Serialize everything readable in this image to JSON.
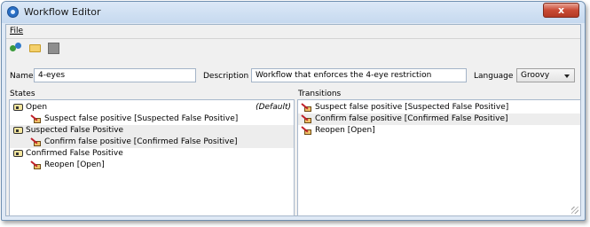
{
  "window": {
    "title": "Workflow Editor",
    "close_label": "x"
  },
  "menu": {
    "file": "File"
  },
  "toolbar": {
    "buttons": [
      {
        "icon": "new-workflow-icon"
      },
      {
        "icon": "open-folder-icon"
      },
      {
        "icon": "save-icon"
      }
    ]
  },
  "form": {
    "name_label": "Name",
    "name_value": "4-eyes",
    "description_label": "Description",
    "description_value": "Workflow that enforces the 4-eye restriction",
    "language_label": "Language",
    "language_value": "Groovy"
  },
  "states": {
    "label": "States",
    "default_tag": "(Default)",
    "rows": [
      {
        "kind": "state",
        "text": "Open"
      },
      {
        "kind": "transition",
        "text": "Suspect false positive [Suspected False Positive]"
      },
      {
        "kind": "state",
        "text": "Suspected False Positive"
      },
      {
        "kind": "transition",
        "text": "Confirm false positive [Confirmed False Positive]"
      },
      {
        "kind": "state",
        "text": "Confirmed False Positive"
      },
      {
        "kind": "transition",
        "text": "Reopen [Open]"
      }
    ]
  },
  "transitions": {
    "label": "Transitions",
    "rows": [
      {
        "text": "Suspect false positive [Suspected False Positive]"
      },
      {
        "text": "Confirm false positive [Confirmed False Positive]"
      },
      {
        "text": "Reopen [Open]"
      }
    ]
  }
}
